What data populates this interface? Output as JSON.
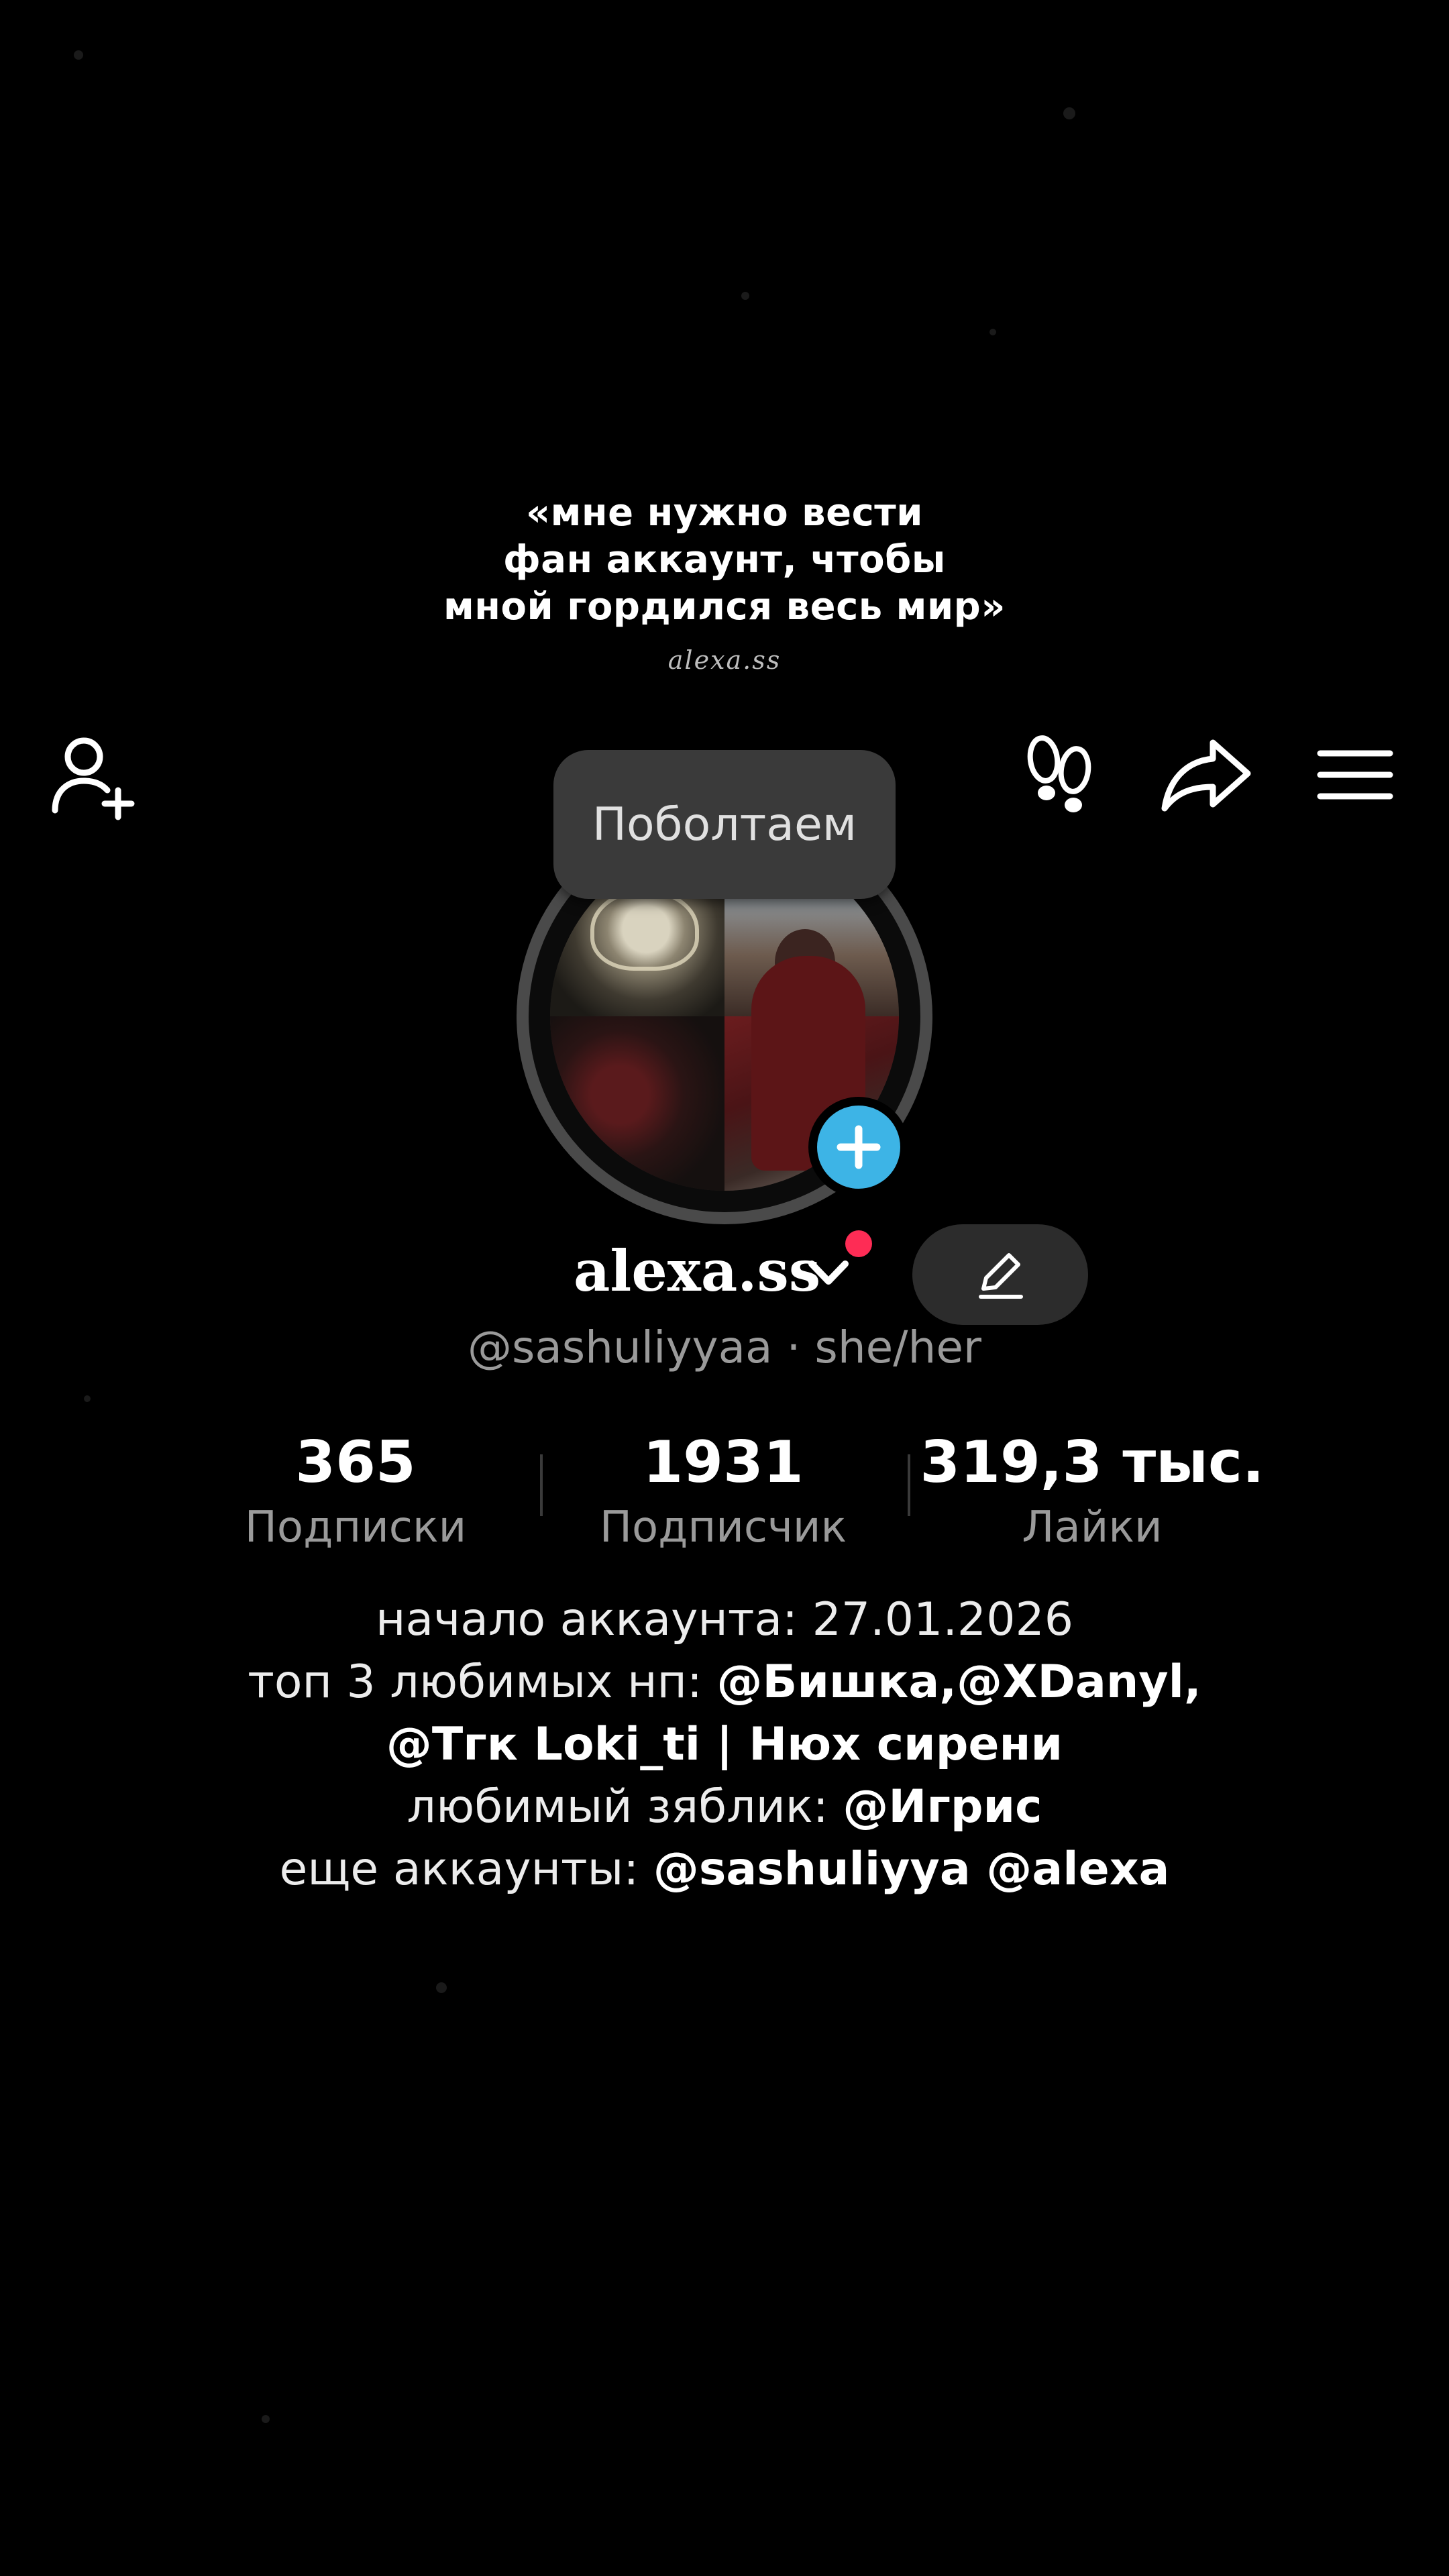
{
  "banner": {
    "quote_line1": "«мне нужно вести",
    "quote_line2": "фан аккаунт, чтобы",
    "quote_line3": "мной гордился весь мир»",
    "signature": "alexa.ss"
  },
  "top_bar": {
    "add_friend_icon": "add-friend-icon",
    "footprint_icon": "footprints-icon",
    "share_icon": "share-arrow-icon",
    "menu_icon": "hamburger-menu-icon"
  },
  "chat_tooltip": {
    "label": "Поболтаем"
  },
  "profile": {
    "display_name": "alexa.ss",
    "handle_line": "@sashuliyyaa · she/her",
    "notification_color": "#fe2c55",
    "add_story_color": "#3db4e6"
  },
  "stats": {
    "following": {
      "value": "365",
      "label": "Подписки"
    },
    "followers": {
      "value": "1931",
      "label": "Подписчик"
    },
    "likes": {
      "value": "319,3 тыс.",
      "label": "Лайки"
    }
  },
  "bio": {
    "line1_text": "начало аккаунта: 27.01.2026",
    "line2_prefix": "топ 3 любимых нп: ",
    "line2_mentions": "@Бишка,@XDanyl,",
    "line3_mentions": "@Тгк Loki_ti | Нюх сирени",
    "line4_prefix": "любимый зяблик: ",
    "line4_mention": "@Игрис",
    "line5_prefix": "еще аккаунты: ",
    "line5_mentions": "@sashuliyya @alexa"
  }
}
